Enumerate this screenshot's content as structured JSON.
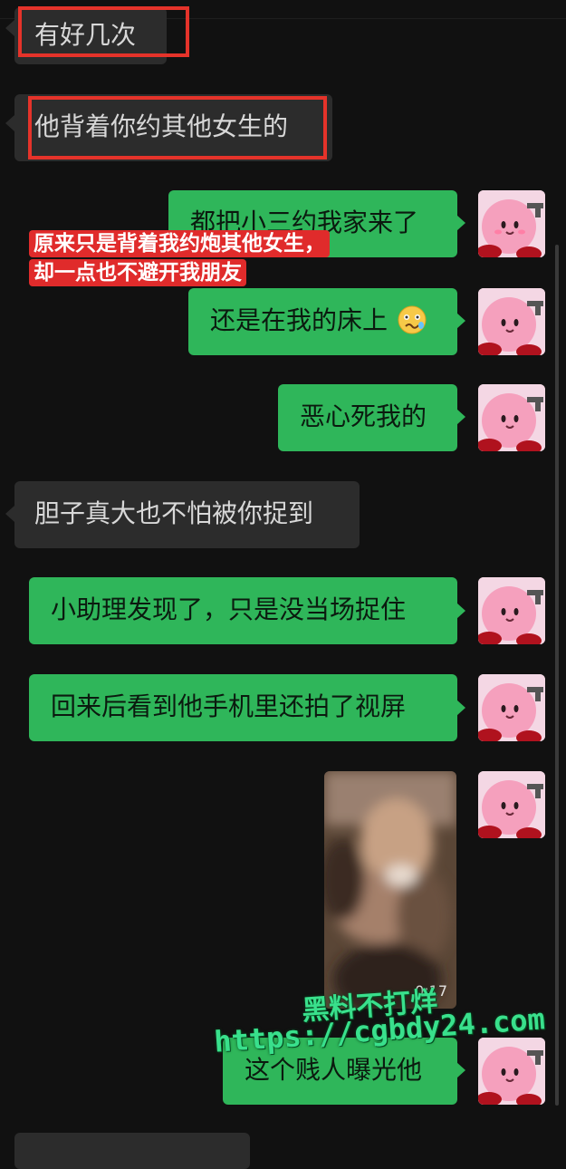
{
  "messages": [
    {
      "side": "in",
      "text": "有好几次"
    },
    {
      "side": "in",
      "text": "他背着你约其他女生的"
    },
    {
      "side": "out",
      "text": "都把小三约我家来了"
    },
    {
      "side": "out",
      "text": "还是在我的床上",
      "emoji": "woozy-face-icon"
    },
    {
      "side": "out",
      "text": "恶心死我的"
    },
    {
      "side": "in",
      "text": "胆子真大也不怕被你捉到"
    },
    {
      "side": "out",
      "text": "小助理发现了，只是没当场捉住"
    },
    {
      "side": "out",
      "text": "回来后看到他手机里还拍了视屏"
    },
    {
      "side": "out",
      "type": "video",
      "duration": "0:17"
    },
    {
      "side": "out",
      "text": "这个贱人曝光他"
    }
  ],
  "annotation": {
    "line1": "原来只是背着我约炮其他女生，",
    "line2": "却一点也不避开我朋友"
  },
  "watermark": {
    "line1": "黑料不打烊",
    "line2": "https://cgbdy24.com"
  },
  "colors": {
    "background": "#111111",
    "incoming_bubble": "#2c2c2c",
    "outgoing_bubble": "#2fb65a",
    "highlight_box": "#e5332a",
    "annotation_bg": "#e02b2b",
    "watermark": "#39e08c"
  },
  "icons": {
    "avatar": "pink-plush-avatar-icon",
    "emoji": "woozy-face-icon"
  }
}
